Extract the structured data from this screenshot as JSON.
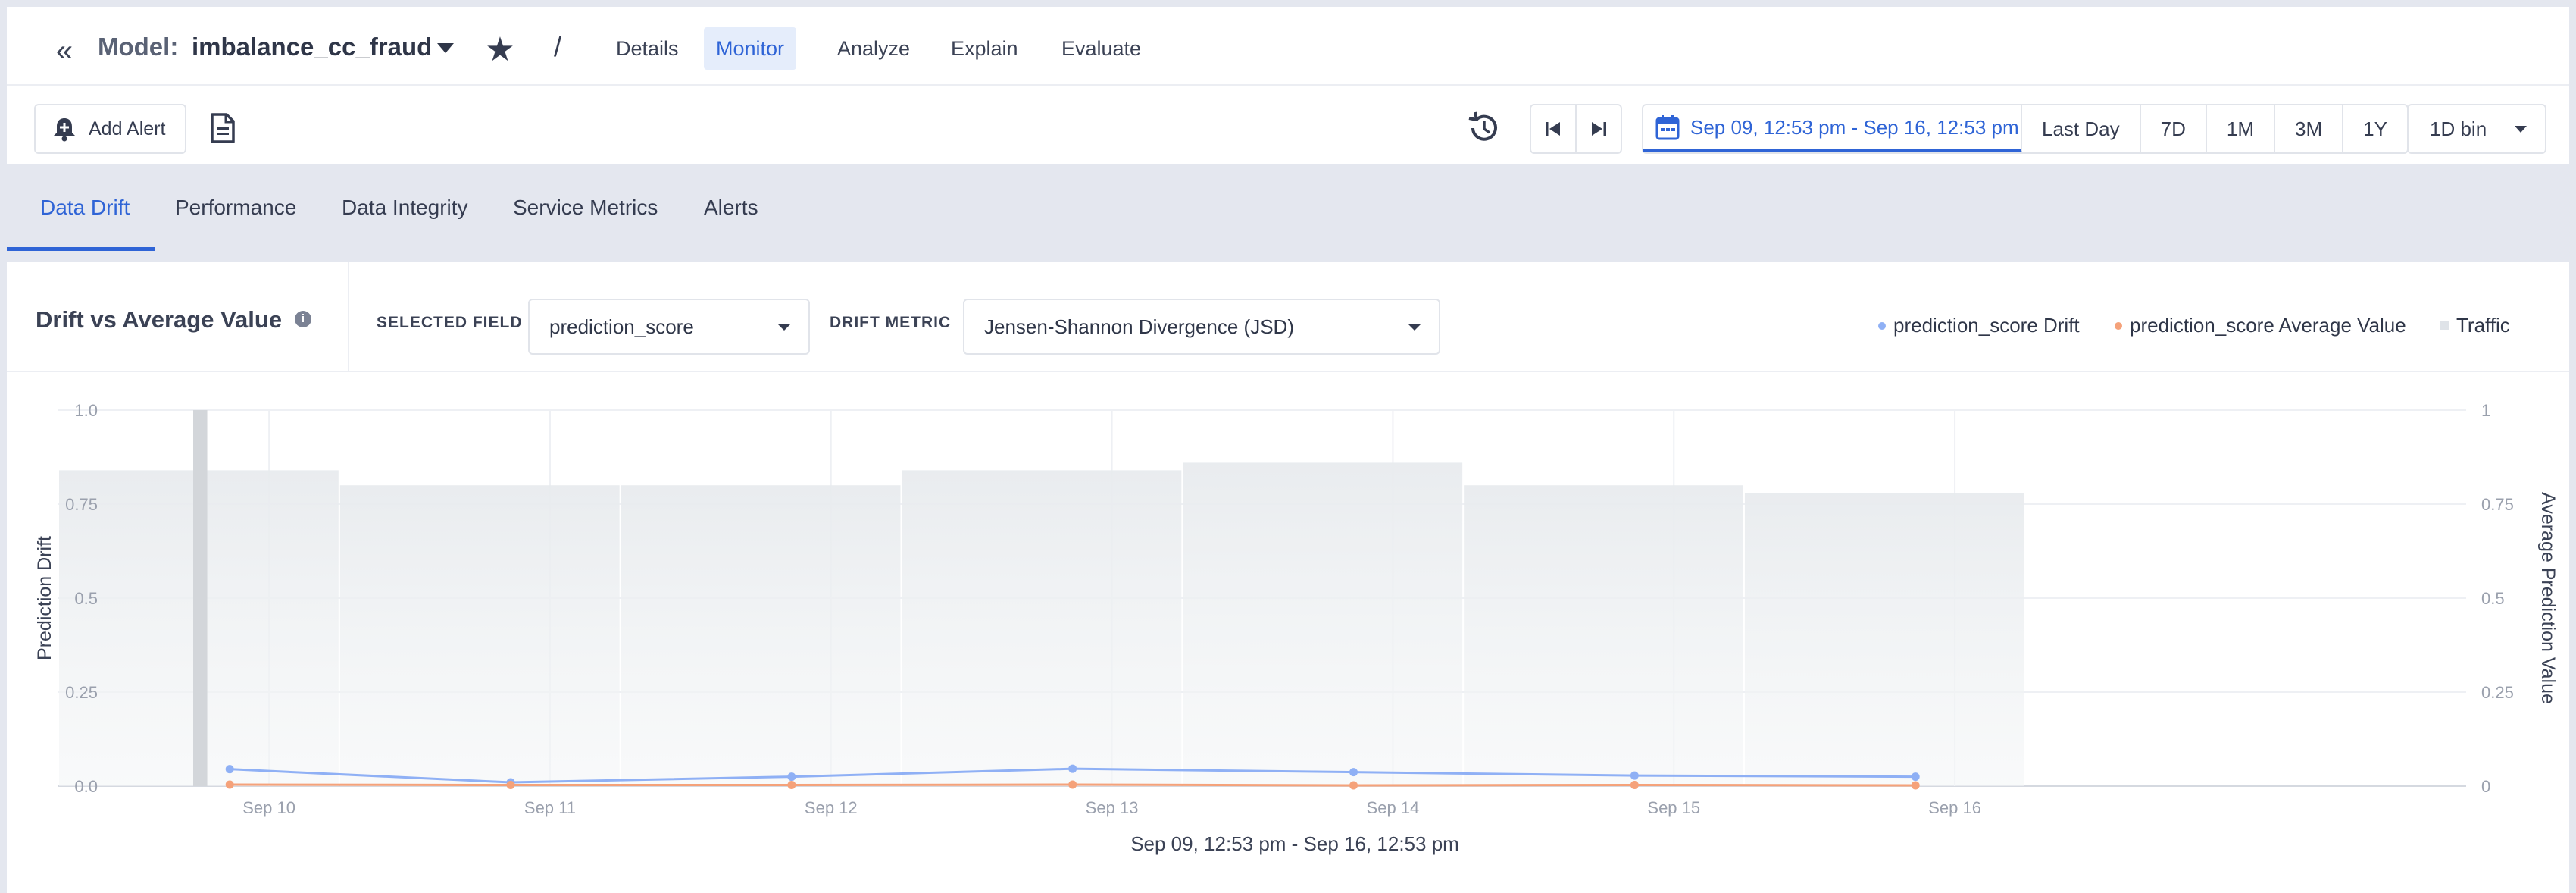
{
  "header": {
    "collapse_glyph": "«",
    "model_label": "Model:",
    "model_name": "imbalance_cc_fraud",
    "separator": "/",
    "tabs": [
      {
        "label": "Details",
        "active": false
      },
      {
        "label": "Monitor",
        "active": true
      },
      {
        "label": "Analyze",
        "active": false
      },
      {
        "label": "Explain",
        "active": false
      },
      {
        "label": "Evaluate",
        "active": false
      }
    ]
  },
  "toolbar": {
    "add_alert_label": "Add Alert",
    "date_range": "Sep 09, 12:53 pm - Sep 16, 12:53 pm",
    "range_buttons": [
      "Last Day",
      "7D",
      "1M",
      "3M",
      "1Y"
    ],
    "bin_label": "1D bin",
    "icons": [
      "bell-plus-icon",
      "document-icon",
      "history-icon",
      "skip-first-icon",
      "skip-last-icon",
      "calendar-icon"
    ]
  },
  "subtabs": [
    {
      "label": "Data Drift",
      "active": true
    },
    {
      "label": "Performance",
      "active": false
    },
    {
      "label": "Data Integrity",
      "active": false
    },
    {
      "label": "Service Metrics",
      "active": false
    },
    {
      "label": "Alerts",
      "active": false
    }
  ],
  "panel": {
    "title": "Drift vs Average Value",
    "info_glyph": "i",
    "selected_field_label": "SELECTED FIELD",
    "selected_field_value": "prediction_score",
    "drift_metric_label": "DRIFT METRIC",
    "drift_metric_value": "Jensen-Shannon Divergence (JSD)",
    "legend": [
      {
        "label": "prediction_score Drift",
        "color": "#8fb0f5"
      },
      {
        "label": "prediction_score Average Value",
        "color": "#f5a27a"
      },
      {
        "label": "Traffic",
        "color": "#dfe3e8"
      }
    ]
  },
  "chart_data": {
    "type": "line",
    "title": "",
    "xlabel": "Sep 09, 12:53 pm - Sep 16, 12:53 pm",
    "ylabel": "Prediction Drift",
    "y2label": "Average Prediction Value",
    "ylim": [
      0,
      1
    ],
    "y2lim": [
      0,
      1
    ],
    "y_ticks": [
      "0.0",
      "0.25",
      "0.5",
      "0.75",
      "1.0"
    ],
    "y2_ticks": [
      "0",
      "0.25",
      "0.5",
      "0.75",
      "1"
    ],
    "x_ticks": [
      "Sep 10",
      "Sep 11",
      "Sep 12",
      "Sep 13",
      "Sep 14",
      "Sep 15",
      "Sep 16"
    ],
    "x_range_days": [
      9.25,
      17.82
    ],
    "grid": true,
    "legend_position": "top-right",
    "series": [
      {
        "name": "prediction_score Drift",
        "color": "#8fb0f5",
        "x": [
          9.86,
          10.86,
          11.86,
          12.86,
          13.86,
          14.86,
          15.86
        ],
        "values": [
          0.045,
          0.01,
          0.025,
          0.046,
          0.037,
          0.028,
          0.025
        ]
      },
      {
        "name": "prediction_score Average Value",
        "color": "#f5a27a",
        "axis": "right",
        "x": [
          9.86,
          10.86,
          11.86,
          12.86,
          13.86,
          14.86,
          15.86
        ],
        "values": [
          0.004,
          0.003,
          0.003,
          0.004,
          0.002,
          0.003,
          0.002
        ]
      }
    ],
    "traffic": {
      "name": "Traffic",
      "color": "#eceff1",
      "bins": [
        {
          "start": 9.25,
          "end": 10.25,
          "value": 0.84
        },
        {
          "start": 10.25,
          "end": 11.25,
          "value": 0.8
        },
        {
          "start": 11.25,
          "end": 12.25,
          "value": 0.8
        },
        {
          "start": 12.25,
          "end": 13.25,
          "value": 0.84
        },
        {
          "start": 13.25,
          "end": 14.25,
          "value": 0.86
        },
        {
          "start": 14.25,
          "end": 15.25,
          "value": 0.8
        },
        {
          "start": 15.25,
          "end": 16.25,
          "value": 0.78
        }
      ]
    },
    "highlight_bin": {
      "start": 9.73,
      "end": 9.78,
      "value": 1.0
    }
  }
}
